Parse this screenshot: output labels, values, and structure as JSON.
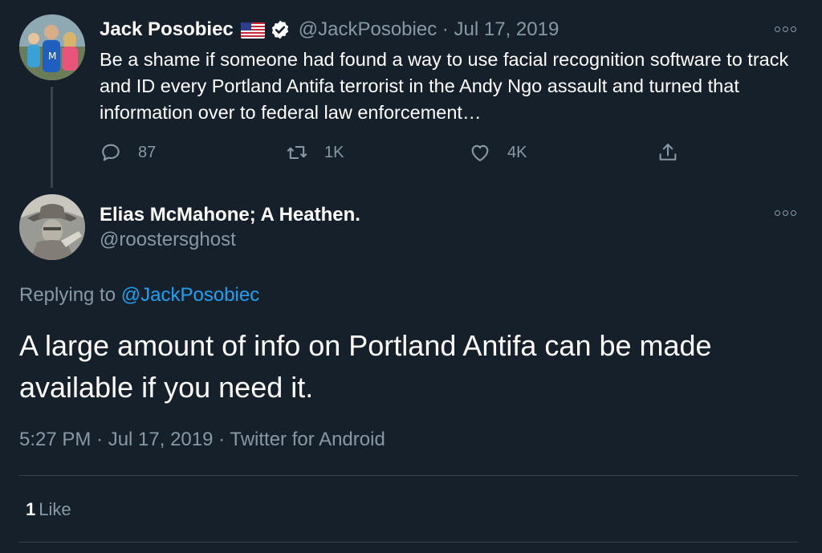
{
  "parent_tweet": {
    "display_name": "Jack Posobiec",
    "handle_date": "@JackPosobiec · Jul 17, 2019",
    "text": "Be a shame if someone had found a way to use facial recognition software to track and ID every Portland Antifa terrorist in the Andy Ngo assault and turned that information over to federal law enforcement…",
    "replies": "87",
    "retweets": "1K",
    "likes": "4K",
    "icons": {
      "flag": "us-flag-icon",
      "verified": "verified-badge-icon",
      "more": "more-options-icon",
      "reply": "reply-icon",
      "retweet": "retweet-icon",
      "like": "heart-icon",
      "share": "share-icon"
    }
  },
  "main_tweet": {
    "display_name": "Elias McMahone; A Heathen.",
    "handle": "@roostersghost",
    "replying_prefix": "Replying to ",
    "replying_mention": "@JackPosobiec",
    "text": "A large amount of info on Portland Antifa can be made available if you need it.",
    "meta": "5:27 PM · Jul 17, 2019 · Twitter for Android",
    "like_count": "1",
    "like_label": "Like"
  },
  "colors": {
    "background": "#15202b",
    "secondary_text": "#8899a6",
    "accent": "#1da1f2",
    "border": "#38444d"
  }
}
